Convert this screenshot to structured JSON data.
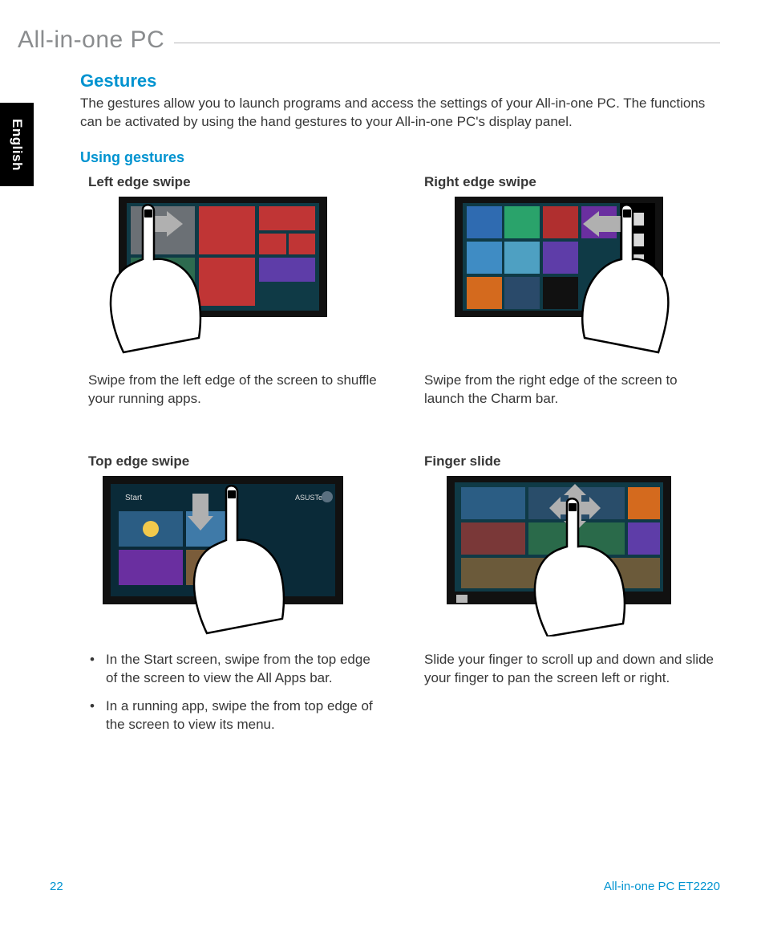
{
  "header": {
    "product_line": "All-in-one PC"
  },
  "language_tab": "English",
  "section": {
    "title": "Gestures",
    "intro": "The gestures allow you to launch programs and access the settings of your All-in-one PC. The functions can be activated by using the hand gestures to your All-in-one PC's display panel.",
    "subheading": "Using gestures"
  },
  "gestures": {
    "left_edge": {
      "title": "Left edge swipe",
      "caption": "Swipe from the left edge of the screen to shuffle your running apps."
    },
    "right_edge": {
      "title": "Right edge swipe",
      "caption": "Swipe from the right edge of the screen to launch the Charm bar."
    },
    "top_edge": {
      "title": "Top edge swipe",
      "bullets": [
        "In the Start screen, swipe from the top edge of the screen to view the All Apps bar.",
        "In a running app, swipe the from top edge of the screen to view its menu."
      ]
    },
    "finger_slide": {
      "title": "Finger slide",
      "caption": "Slide your finger to scroll up and down and slide your finger to pan the screen left or right."
    }
  },
  "footer": {
    "page_number": "22",
    "model": "All-in-one PC ET2220"
  }
}
